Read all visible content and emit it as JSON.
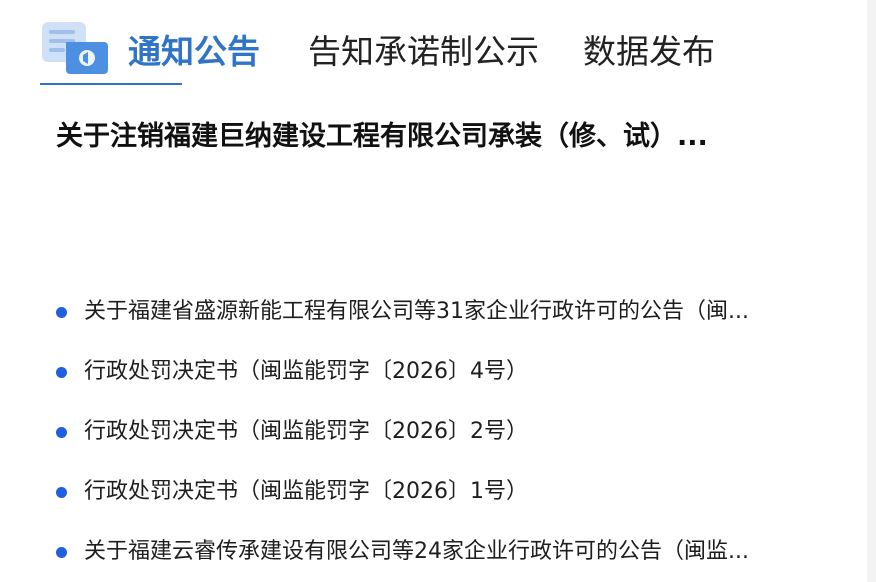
{
  "tabs": [
    {
      "label": "通知公告",
      "active": true
    },
    {
      "label": "告知承诺制公示",
      "active": false
    },
    {
      "label": "数据发布",
      "active": false
    }
  ],
  "headline": "关于注销福建巨纳建设工程有限公司承装（修、试）...",
  "news": [
    "关于福建省盛源新能工程有限公司等31家企业行政许可的公告（闽...",
    "行政处罚决定书（闽监能罚字〔2026〕4号）",
    "行政处罚决定书（闽监能罚字〔2026〕2号）",
    "行政处罚决定书（闽监能罚字〔2026〕1号）",
    "关于福建云睿传承建设有限公司等24家企业行政许可的公告（闽监..."
  ],
  "colors": {
    "accent": "#2f74c7",
    "bullet": "#1f5fe0",
    "text": "#1e1e1e"
  },
  "icons": {
    "tab_icon": "notice-megaphone-icon"
  }
}
